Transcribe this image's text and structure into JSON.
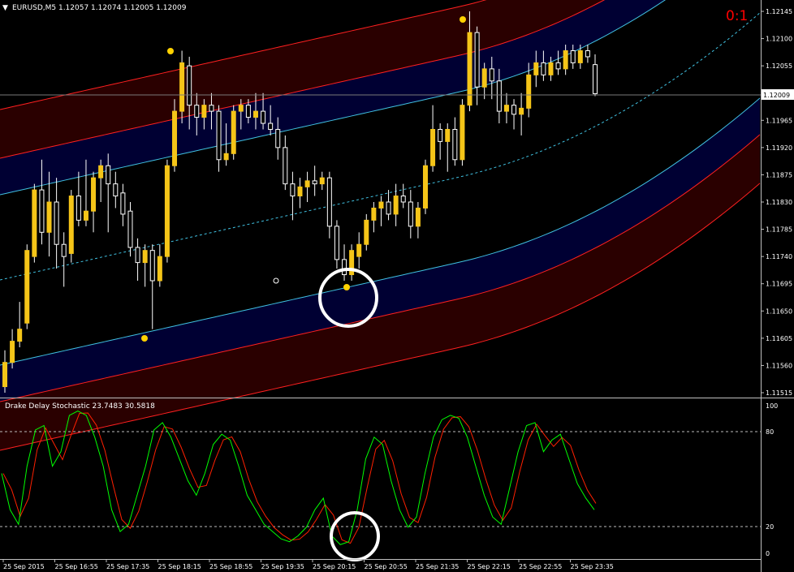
{
  "main_header": {
    "arrow": "▼",
    "text": "EURUSD,M5  1.12057 1.12074 1.12005 1.12009"
  },
  "score": "0:1",
  "current_price": "1.12009",
  "price_axis": [
    "1.12145",
    "1.12100",
    "1.12055",
    "1.12009",
    "1.11965",
    "1.11920",
    "1.11875",
    "1.11830",
    "1.11785",
    "1.11740",
    "1.11695",
    "1.11650",
    "1.11605",
    "1.11560",
    "1.11515"
  ],
  "indicator_header": "Drake Delay Stochastic 23.7483 30.5818",
  "indicator_axis": [
    "100",
    "80",
    "20",
    "0"
  ],
  "time_axis": [
    "25 Sep 2015",
    "25 Sep 16:55",
    "25 Sep 17:35",
    "25 Sep 18:15",
    "25 Sep 18:55",
    "25 Sep 19:35",
    "25 Sep 20:15",
    "25 Sep 20:55",
    "25 Sep 21:35",
    "25 Sep 22:15",
    "25 Sep 22:55",
    "25 Sep 23:35"
  ],
  "colors": {
    "background": "#000000",
    "bull_candle": "#f5c518",
    "bear_candle": "#000000",
    "wick": "#ffffff",
    "outer_band": "#2a0000",
    "inner_band": "#000033",
    "red_line": "#ff2020",
    "cyan_line": "#40c0e0",
    "stoch_main": "#00ff00",
    "stoch_signal": "#ff2000",
    "score": "#ff0000",
    "marker": "#ffd200"
  },
  "candles": [
    {
      "o": 1.11525,
      "h": 1.11585,
      "l": 1.11515,
      "c": 1.11565
    },
    {
      "o": 1.11565,
      "h": 1.1162,
      "l": 1.11555,
      "c": 1.116
    },
    {
      "o": 1.116,
      "h": 1.11665,
      "l": 1.1159,
      "c": 1.1162
    },
    {
      "o": 1.1163,
      "h": 1.1176,
      "l": 1.1162,
      "c": 1.1175
    },
    {
      "o": 1.1174,
      "h": 1.1186,
      "l": 1.1173,
      "c": 1.1185
    },
    {
      "o": 1.1185,
      "h": 1.119,
      "l": 1.1176,
      "c": 1.1178
    },
    {
      "o": 1.1178,
      "h": 1.1188,
      "l": 1.1174,
      "c": 1.1183
    },
    {
      "o": 1.1183,
      "h": 1.1187,
      "l": 1.1172,
      "c": 1.1176
    },
    {
      "o": 1.1176,
      "h": 1.1178,
      "l": 1.1169,
      "c": 1.1174
    },
    {
      "o": 1.11745,
      "h": 1.1185,
      "l": 1.1173,
      "c": 1.1184
    },
    {
      "o": 1.1184,
      "h": 1.1188,
      "l": 1.1179,
      "c": 1.118
    },
    {
      "o": 1.118,
      "h": 1.119,
      "l": 1.1179,
      "c": 1.11815
    },
    {
      "o": 1.11815,
      "h": 1.1188,
      "l": 1.1178,
      "c": 1.1187
    },
    {
      "o": 1.1187,
      "h": 1.119,
      "l": 1.1183,
      "c": 1.1189
    },
    {
      "o": 1.1189,
      "h": 1.1191,
      "l": 1.1178,
      "c": 1.1186
    },
    {
      "o": 1.1186,
      "h": 1.1188,
      "l": 1.1182,
      "c": 1.1184
    },
    {
      "o": 1.11845,
      "h": 1.1186,
      "l": 1.1179,
      "c": 1.1181
    },
    {
      "o": 1.11815,
      "h": 1.1183,
      "l": 1.1174,
      "c": 1.11755
    },
    {
      "o": 1.11755,
      "h": 1.1177,
      "l": 1.117,
      "c": 1.1173
    },
    {
      "o": 1.1173,
      "h": 1.1176,
      "l": 1.1169,
      "c": 1.1175
    },
    {
      "o": 1.1175,
      "h": 1.1176,
      "l": 1.1162,
      "c": 1.117
    },
    {
      "o": 1.117,
      "h": 1.1176,
      "l": 1.1169,
      "c": 1.1174
    },
    {
      "o": 1.1174,
      "h": 1.119,
      "l": 1.1173,
      "c": 1.1189
    },
    {
      "o": 1.1189,
      "h": 1.12,
      "l": 1.1188,
      "c": 1.1198
    },
    {
      "o": 1.1198,
      "h": 1.1208,
      "l": 1.1196,
      "c": 1.1206
    },
    {
      "o": 1.12055,
      "h": 1.1207,
      "l": 1.1195,
      "c": 1.1199
    },
    {
      "o": 1.1199,
      "h": 1.1201,
      "l": 1.1194,
      "c": 1.1197
    },
    {
      "o": 1.1197,
      "h": 1.12,
      "l": 1.1195,
      "c": 1.1199
    },
    {
      "o": 1.1199,
      "h": 1.1201,
      "l": 1.1195,
      "c": 1.1198
    },
    {
      "o": 1.1198,
      "h": 1.1199,
      "l": 1.1188,
      "c": 1.119
    },
    {
      "o": 1.119,
      "h": 1.1196,
      "l": 1.1189,
      "c": 1.1191
    },
    {
      "o": 1.1191,
      "h": 1.1199,
      "l": 1.119,
      "c": 1.1198
    },
    {
      "o": 1.1198,
      "h": 1.12,
      "l": 1.1195,
      "c": 1.1199
    },
    {
      "o": 1.1199,
      "h": 1.12,
      "l": 1.1196,
      "c": 1.1197
    },
    {
      "o": 1.1197,
      "h": 1.1201,
      "l": 1.1195,
      "c": 1.1198
    },
    {
      "o": 1.1198,
      "h": 1.1201,
      "l": 1.1195,
      "c": 1.1196
    },
    {
      "o": 1.1196,
      "h": 1.1199,
      "l": 1.1194,
      "c": 1.1195
    },
    {
      "o": 1.1195,
      "h": 1.1197,
      "l": 1.119,
      "c": 1.1192
    },
    {
      "o": 1.1192,
      "h": 1.1194,
      "l": 1.1185,
      "c": 1.1186
    },
    {
      "o": 1.1186,
      "h": 1.1188,
      "l": 1.118,
      "c": 1.1184
    },
    {
      "o": 1.1184,
      "h": 1.1187,
      "l": 1.1182,
      "c": 1.11855
    },
    {
      "o": 1.11855,
      "h": 1.1188,
      "l": 1.1183,
      "c": 1.11865
    },
    {
      "o": 1.11865,
      "h": 1.1189,
      "l": 1.1184,
      "c": 1.1186
    },
    {
      "o": 1.1186,
      "h": 1.1188,
      "l": 1.1185,
      "c": 1.1187
    },
    {
      "o": 1.1187,
      "h": 1.1188,
      "l": 1.1177,
      "c": 1.1179
    },
    {
      "o": 1.1179,
      "h": 1.118,
      "l": 1.1172,
      "c": 1.11735
    },
    {
      "o": 1.11735,
      "h": 1.1176,
      "l": 1.117,
      "c": 1.1171
    },
    {
      "o": 1.1171,
      "h": 1.1176,
      "l": 1.117,
      "c": 1.1175
    },
    {
      "o": 1.1174,
      "h": 1.1178,
      "l": 1.1172,
      "c": 1.1176
    },
    {
      "o": 1.1176,
      "h": 1.1181,
      "l": 1.1175,
      "c": 1.118
    },
    {
      "o": 1.118,
      "h": 1.1183,
      "l": 1.1178,
      "c": 1.1182
    },
    {
      "o": 1.1182,
      "h": 1.1184,
      "l": 1.1179,
      "c": 1.1183
    },
    {
      "o": 1.1183,
      "h": 1.1185,
      "l": 1.118,
      "c": 1.1181
    },
    {
      "o": 1.1181,
      "h": 1.1186,
      "l": 1.1179,
      "c": 1.1184
    },
    {
      "o": 1.1184,
      "h": 1.1186,
      "l": 1.1182,
      "c": 1.1183
    },
    {
      "o": 1.1183,
      "h": 1.1185,
      "l": 1.1177,
      "c": 1.1179
    },
    {
      "o": 1.1179,
      "h": 1.1183,
      "l": 1.1177,
      "c": 1.1182
    },
    {
      "o": 1.1182,
      "h": 1.119,
      "l": 1.1181,
      "c": 1.1189
    },
    {
      "o": 1.1189,
      "h": 1.1199,
      "l": 1.1188,
      "c": 1.1195
    },
    {
      "o": 1.1195,
      "h": 1.1196,
      "l": 1.119,
      "c": 1.1193
    },
    {
      "o": 1.1193,
      "h": 1.1196,
      "l": 1.1188,
      "c": 1.1195
    },
    {
      "o": 1.1195,
      "h": 1.1197,
      "l": 1.1189,
      "c": 1.119
    },
    {
      "o": 1.119,
      "h": 1.12,
      "l": 1.1189,
      "c": 1.1199
    },
    {
      "o": 1.1199,
      "h": 1.12145,
      "l": 1.1198,
      "c": 1.1211
    },
    {
      "o": 1.1211,
      "h": 1.1212,
      "l": 1.1199,
      "c": 1.1202
    },
    {
      "o": 1.1202,
      "h": 1.1206,
      "l": 1.12,
      "c": 1.1205
    },
    {
      "o": 1.1205,
      "h": 1.1207,
      "l": 1.12,
      "c": 1.1203
    },
    {
      "o": 1.1203,
      "h": 1.1205,
      "l": 1.1196,
      "c": 1.1198
    },
    {
      "o": 1.1198,
      "h": 1.1201,
      "l": 1.1196,
      "c": 1.1199
    },
    {
      "o": 1.1199,
      "h": 1.12,
      "l": 1.1195,
      "c": 1.11975
    },
    {
      "o": 1.11975,
      "h": 1.1201,
      "l": 1.1194,
      "c": 1.11985
    },
    {
      "o": 1.11985,
      "h": 1.1206,
      "l": 1.1197,
      "c": 1.1204
    },
    {
      "o": 1.1204,
      "h": 1.1208,
      "l": 1.1202,
      "c": 1.1206
    },
    {
      "o": 1.1206,
      "h": 1.1208,
      "l": 1.1203,
      "c": 1.1204
    },
    {
      "o": 1.1204,
      "h": 1.1207,
      "l": 1.1203,
      "c": 1.1206
    },
    {
      "o": 1.1206,
      "h": 1.1208,
      "l": 1.1204,
      "c": 1.1205
    },
    {
      "o": 1.1205,
      "h": 1.1209,
      "l": 1.1204,
      "c": 1.1208
    },
    {
      "o": 1.1208,
      "h": 1.1209,
      "l": 1.1205,
      "c": 1.1206
    },
    {
      "o": 1.1206,
      "h": 1.1209,
      "l": 1.1205,
      "c": 1.1208
    },
    {
      "o": 1.1208,
      "h": 1.1209,
      "l": 1.1206,
      "c": 1.1207
    },
    {
      "o": 1.12057,
      "h": 1.12074,
      "l": 1.12005,
      "c": 1.12009
    }
  ],
  "stoch_main": [
    55,
    30,
    20,
    60,
    85,
    88,
    60,
    70,
    95,
    98,
    95,
    80,
    60,
    30,
    15,
    20,
    40,
    60,
    85,
    90,
    80,
    65,
    50,
    40,
    55,
    75,
    82,
    78,
    60,
    40,
    30,
    20,
    15,
    10,
    8,
    12,
    18,
    30,
    38,
    12,
    6,
    8,
    30,
    65,
    80,
    75,
    50,
    30,
    18,
    25,
    55,
    80,
    92,
    95,
    93,
    80,
    60,
    40,
    25,
    20,
    45,
    70,
    88,
    90,
    70,
    78,
    82,
    65,
    48,
    38,
    30
  ]
}
